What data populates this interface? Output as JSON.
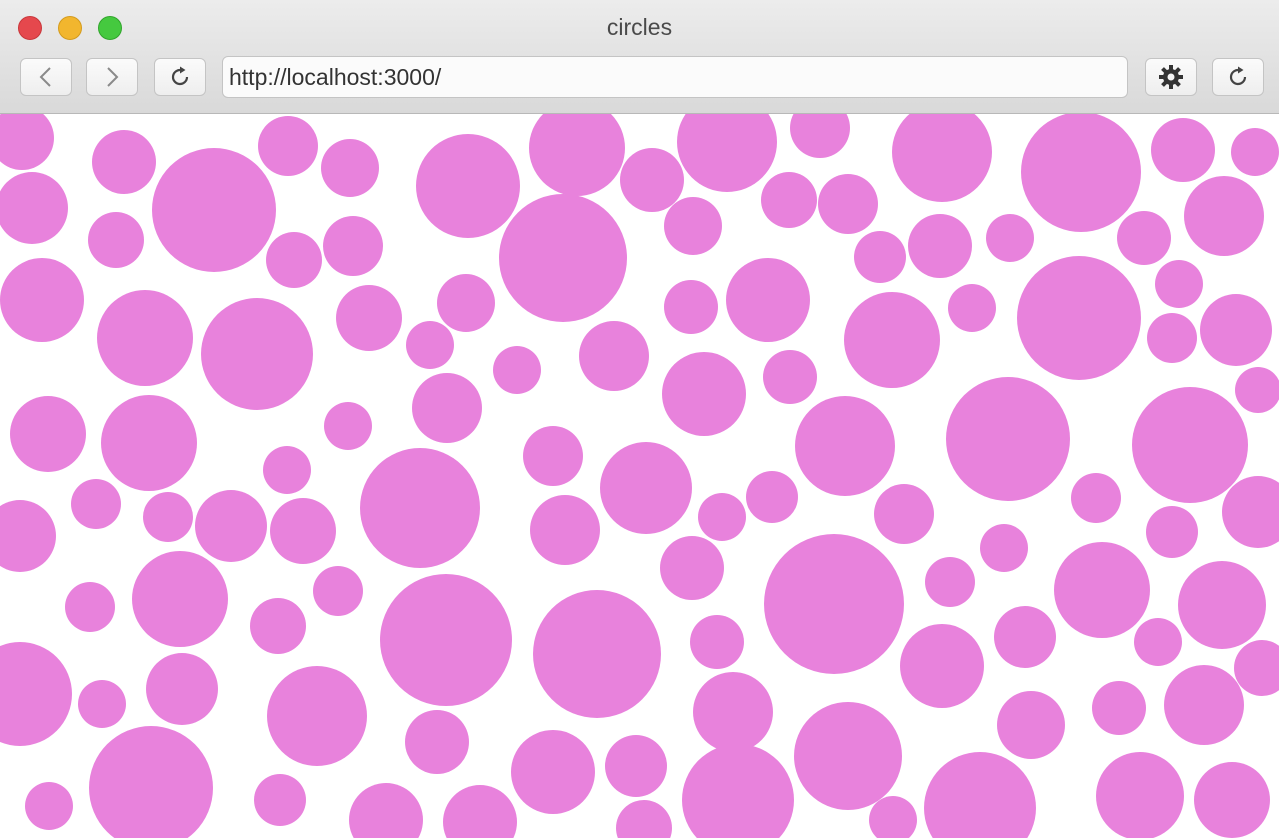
{
  "window": {
    "title": "circles",
    "traffic_lights": {
      "close": "#e5484d",
      "minimize": "#f2b62e",
      "zoom": "#45c93f"
    }
  },
  "toolbar": {
    "back_icon": "chevron-left-icon",
    "forward_icon": "chevron-right-icon",
    "reload_icon": "reload-icon",
    "settings_icon": "gear-icon",
    "url": "http://localhost:3000/"
  },
  "canvas": {
    "background": "#ffffff",
    "circle_color": "#e882dc"
  }
}
